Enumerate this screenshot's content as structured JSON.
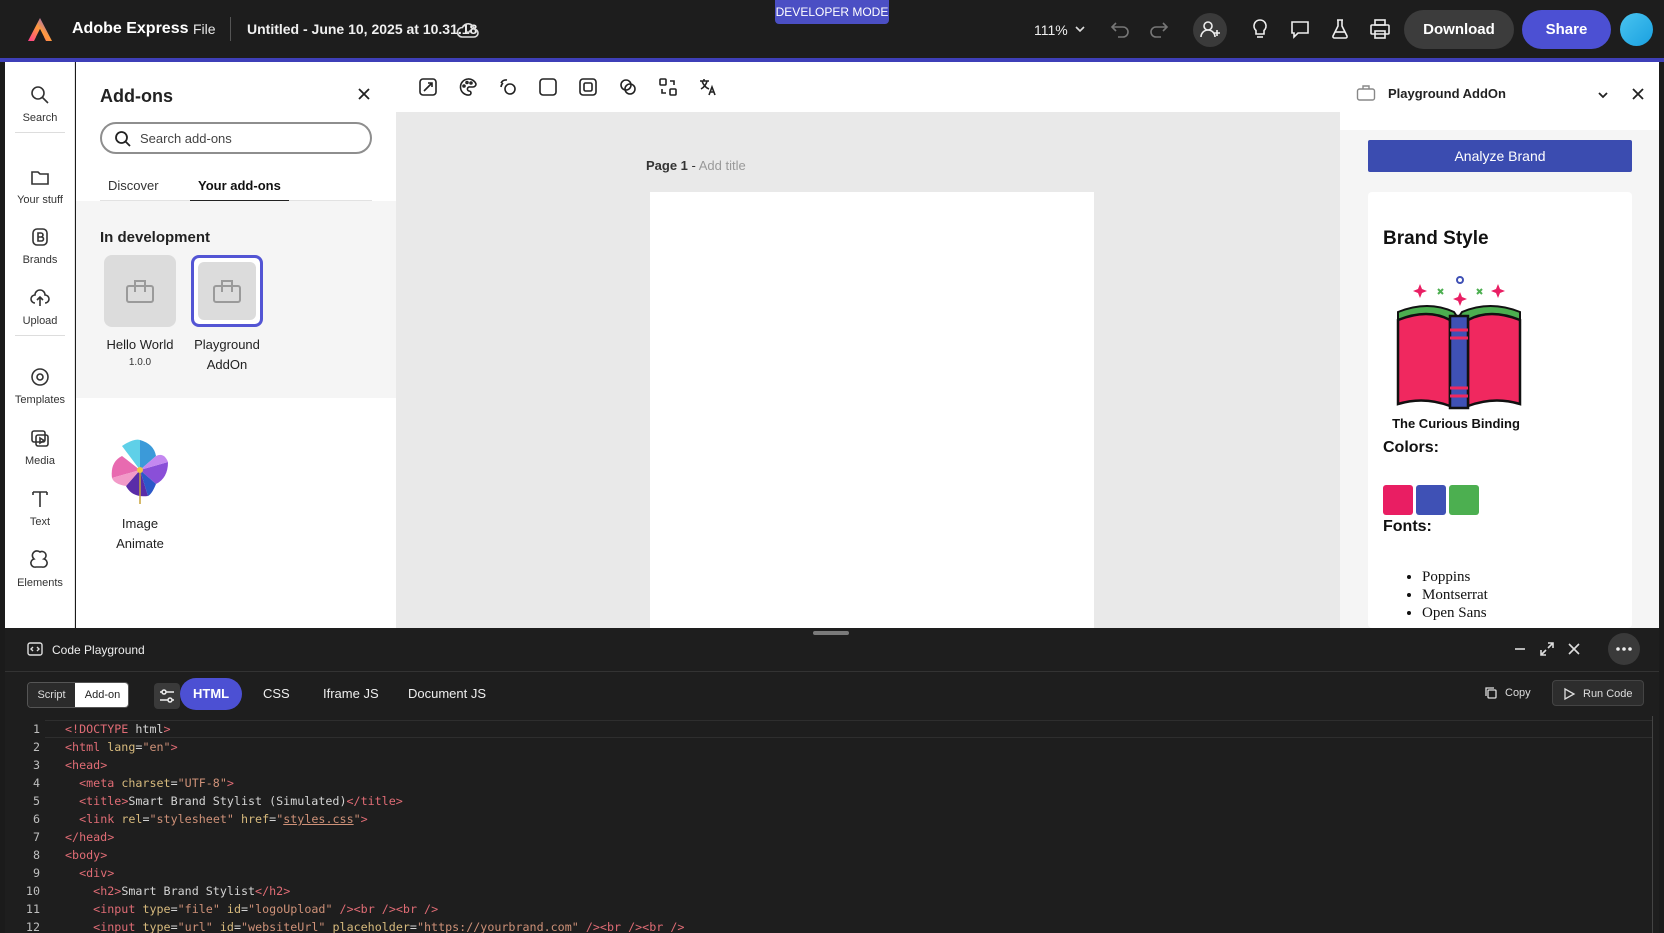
{
  "topbar": {
    "app_name": "Adobe Express",
    "file_menu": "File",
    "doc_title": "Untitled - June 10, 2025 at 10.31.18",
    "dev_mode": "DEVELOPER MODE",
    "zoom": "111%",
    "download": "Download",
    "share": "Share",
    "colors": {
      "brand_blue": "#4c50d3",
      "bg": "#1d1d1d"
    }
  },
  "rail": [
    {
      "label": "Search",
      "icon": "search-icon"
    },
    {
      "label": "Your stuff",
      "icon": "folder-icon"
    },
    {
      "label": "Brands",
      "icon": "brand-icon"
    },
    {
      "label": "Upload",
      "icon": "upload-icon"
    },
    {
      "label": "Templates",
      "icon": "templates-icon"
    },
    {
      "label": "Media",
      "icon": "media-icon"
    },
    {
      "label": "Text",
      "icon": "text-icon"
    },
    {
      "label": "Elements",
      "icon": "elements-icon"
    }
  ],
  "addons": {
    "title": "Add-ons",
    "search_placeholder": "Search add-ons",
    "tabs": [
      "Discover",
      "Your add-ons"
    ],
    "active_tab": "Your add-ons",
    "dev_heading": "In development",
    "dev_items": [
      {
        "name": "Hello World",
        "version": "1.0.0"
      },
      {
        "name": "Playground AddOn",
        "version": ""
      }
    ],
    "other_items": [
      {
        "name": "Image Animate"
      }
    ]
  },
  "canvas": {
    "page_label": "Page 1",
    "page_sep": " - ",
    "title_hint": "Add title"
  },
  "rpanel": {
    "name": "Playground AddOn",
    "analyze": "Analyze Brand",
    "brand_style": "Brand Style",
    "brand_name": "The Curious Binding",
    "colors_heading": "Colors:",
    "colors": [
      "#e91e63",
      "#3f51b5",
      "#4caf50"
    ],
    "fonts_heading": "Fonts:",
    "fonts": [
      "Poppins",
      "Montserrat",
      "Open Sans"
    ]
  },
  "playground": {
    "title": "Code Playground",
    "mode_script": "Script",
    "mode_addon": "Add-on",
    "tabs": [
      "HTML",
      "CSS",
      "Iframe JS",
      "Document JS"
    ],
    "active_tab": "HTML",
    "copy": "Copy",
    "run": "Run Code",
    "code_lines": [
      "<!DOCTYPE html>",
      "<html lang=\"en\">",
      "<head>",
      "  <meta charset=\"UTF-8\">",
      "  <title>Smart Brand Stylist (Simulated)</title>",
      "  <link rel=\"stylesheet\" href=\"styles.css\">",
      "</head>",
      "<body>",
      "  <div>",
      "    <h2>Smart Brand Stylist</h2>",
      "    <input type=\"file\" id=\"logoUpload\" /><br /><br />",
      "    <input type=\"url\" id=\"websiteUrl\" placeholder=\"https://yourbrand.com\" /><br /><br />"
    ]
  }
}
